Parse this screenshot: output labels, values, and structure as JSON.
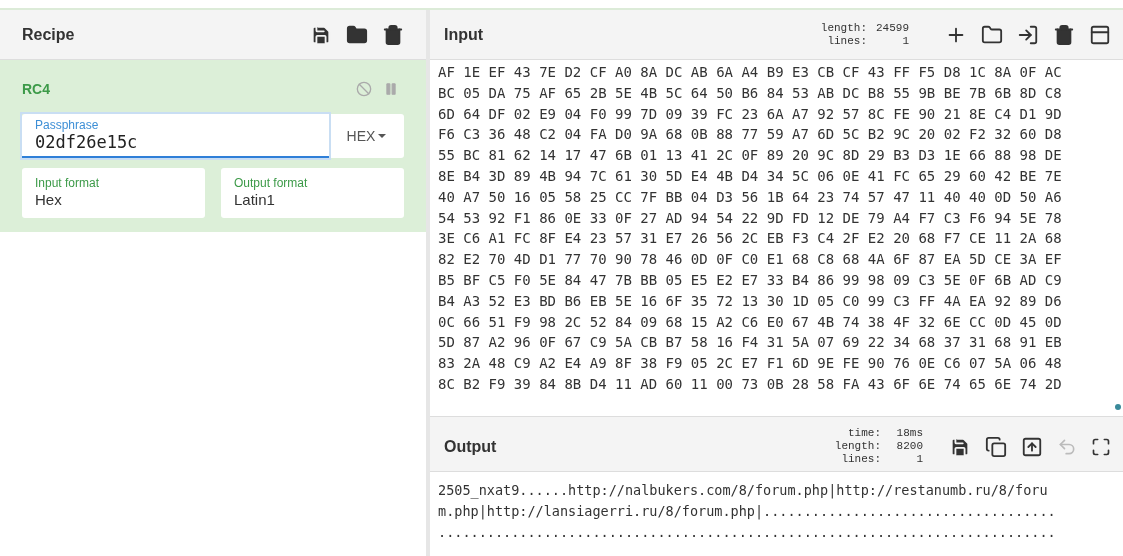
{
  "recipe": {
    "title": "Recipe",
    "operations": [
      {
        "name": "RC4",
        "passphrase": {
          "label": "Passphrase",
          "value": "02df26e15c",
          "format": "HEX",
          "focused": true
        },
        "input_format": {
          "label": "Input format",
          "value": "Hex"
        },
        "output_format": {
          "label": "Output format",
          "value": "Latin1"
        }
      }
    ]
  },
  "input": {
    "title": "Input",
    "stats": [
      {
        "label": "length:",
        "value": "24599"
      },
      {
        "label": "lines:",
        "value": "1"
      }
    ],
    "hex_rows": [
      "AF 1E EF 43 7E D2 CF A0 8A DC AB 6A A4 B9 E3 CB CF 43 FF F5 D8 1C 8A 0F AC",
      "BC 05 DA 75 AF 65 2B 5E 4B 5C 64 50 B6 84 53 AB DC B8 55 9B BE 7B 6B 8D C8",
      "6D 64 DF 02 E9 04 F0 99 7D 09 39 FC 23 6A A7 92 57 8C FE 90 21 8E C4 D1 9D",
      "F6 C3 36 48 C2 04 FA D0 9A 68 0B 88 77 59 A7 6D 5C B2 9C 20 02 F2 32 60 D8",
      "55 BC 81 62 14 17 47 6B 01 13 41 2C 0F 89 20 9C 8D 29 B3 D3 1E 66 88 98 DE",
      "8E B4 3D 89 4B 94 7C 61 30 5D E4 4B D4 34 5C 06 0E 41 FC 65 29 60 42 BE 7E",
      "40 A7 50 16 05 58 25 CC 7F BB 04 D3 56 1B 64 23 74 57 47 11 40 40 0D 50 A6",
      "54 53 92 F1 86 0E 33 0F 27 AD 94 54 22 9D FD 12 DE 79 A4 F7 C3 F6 94 5E 78",
      "3E C6 A1 FC 8F E4 23 57 31 E7 26 56 2C EB F3 C4 2F E2 20 68 F7 CE 11 2A 68",
      "82 E2 70 4D D1 77 70 90 78 46 0D 0F C0 E1 68 C8 68 4A 6F 87 EA 5D CE 3A EF",
      "B5 BF C5 F0 5E 84 47 7B BB 05 E5 E2 E7 33 B4 86 99 98 09 C3 5E 0F 6B AD C9",
      "B4 A3 52 E3 BD B6 EB 5E 16 6F 35 72 13 30 1D 05 C0 99 C3 FF 4A EA 92 89 D6",
      "0C 66 51 F9 98 2C 52 84 09 68 15 A2 C6 E0 67 4B 74 38 4F 32 6E CC 0D 45 0D",
      "5D 87 A2 96 0F 67 C9 5A CB B7 58 16 F4 31 5A 07 69 22 34 68 37 31 68 91 EB",
      "83 2A 48 C9 A2 E4 A9 8F 38 F9 05 2C E7 F1 6D 9E FE 90 76 0E C6 07 5A 06 48",
      "8C B2 F9 39 84 8B D4 11 AD 60 11 00 73 0B 28 58 FA 43 6F 6E 74 65 6E 74 2D"
    ]
  },
  "output": {
    "title": "Output",
    "stats": [
      {
        "label": "time:",
        "value": "18ms"
      },
      {
        "label": "length:",
        "value": "8200"
      },
      {
        "label": "lines:",
        "value": "1"
      }
    ],
    "lines": [
      "2505_nxat9......http://nalbukers.com/8/forum.php|http://restanumb.ru/8/foru",
      "m.php|http://lansiagerri.ru/8/forum.php|....................................",
      "............................................................................"
    ]
  }
}
